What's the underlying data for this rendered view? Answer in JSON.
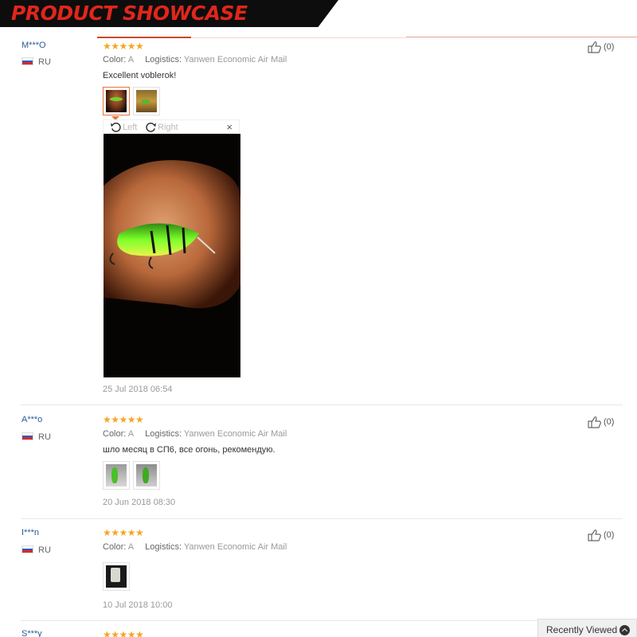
{
  "banner": {
    "title": "PRODUCT SHOWCASE"
  },
  "labels": {
    "color": "Color:",
    "logistics": "Logistics:",
    "rotate_left": "Left",
    "rotate_right": "Right",
    "close": "×"
  },
  "reviews": [
    {
      "user": "M***O",
      "country": "RU",
      "rating": "★★★★★",
      "color": "A",
      "logistics": "Yanwen Economic Air Mail",
      "comment": "Excellent voblerok!",
      "date": "25 Jul 2018 06:54",
      "likes": "(0)"
    },
    {
      "user": "A***o",
      "country": "RU",
      "rating": "★★★★★",
      "color": "A",
      "logistics": "Yanwen Economic Air Mail",
      "comment": "шло месяц в СП6, все огонь, рекомендую.",
      "date": "20 Jun 2018 08:30",
      "likes": "(0)"
    },
    {
      "user": "I***n",
      "country": "RU",
      "rating": "★★★★★",
      "color": "A",
      "logistics": "Yanwen Economic Air Mail",
      "comment": "",
      "date": "10 Jul 2018 10:00",
      "likes": "(0)"
    },
    {
      "user": "S***y",
      "rating": "★★★★★"
    }
  ],
  "recently_viewed": {
    "label": "Recently Viewed"
  },
  "icons": {
    "like": "thumbs-up-icon",
    "flag": "russia-flag-icon",
    "rotate_left": "rotate-left-icon",
    "rotate_right": "rotate-right-icon",
    "collapse": "chevron-up-icon"
  },
  "colors": {
    "accent": "#e0261b",
    "stars": "#f5a623",
    "username": "#2a5a96"
  }
}
